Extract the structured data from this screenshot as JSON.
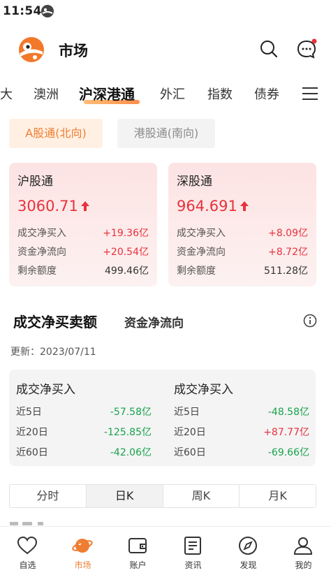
{
  "status_bar": {
    "time": "11:54"
  },
  "header": {
    "title": "市场"
  },
  "market_tabs": [
    {
      "label": "大"
    },
    {
      "label": "澳洲"
    },
    {
      "label": "沪深港通",
      "active": true
    },
    {
      "label": "外汇"
    },
    {
      "label": "指数"
    },
    {
      "label": "债券"
    }
  ],
  "sub_tabs": [
    {
      "label": "A股通(北向)",
      "active": true
    },
    {
      "label": "港股通(南向)"
    }
  ],
  "cards": [
    {
      "title": "沪股通",
      "index": "3060.71",
      "rows": [
        {
          "label": "成交净买入",
          "value": "+19.36亿"
        },
        {
          "label": "资金净流向",
          "value": "+20.54亿"
        },
        {
          "label": "剩余额度",
          "value": "499.46亿"
        }
      ]
    },
    {
      "title": "深股通",
      "index": "964.691",
      "rows": [
        {
          "label": "成交净买入",
          "value": "+8.09亿"
        },
        {
          "label": "资金净流向",
          "value": "+8.72亿"
        },
        {
          "label": "剩余额度",
          "value": "511.28亿"
        }
      ]
    }
  ],
  "section": {
    "tab_net": "成交净买卖额",
    "tab_flow": "资金净流向",
    "update_label": "更新：2023/07/11"
  },
  "period_stats": [
    {
      "title": "成交净买入",
      "rows": [
        {
          "label": "近5日",
          "value": "-57.58亿"
        },
        {
          "label": "近20日",
          "value": "-125.85亿"
        },
        {
          "label": "近60日",
          "value": "-42.06亿"
        }
      ]
    },
    {
      "title": "成交净买入",
      "rows": [
        {
          "label": "近5日",
          "value": "-48.58亿"
        },
        {
          "label": "近20日",
          "value": "+87.77亿"
        },
        {
          "label": "近60日",
          "value": "-69.66亿"
        }
      ]
    }
  ],
  "kline_tabs": [
    {
      "label": "分时"
    },
    {
      "label": "日K",
      "active": true
    },
    {
      "label": "周K"
    },
    {
      "label": "月K"
    }
  ],
  "bottom_nav": [
    {
      "label": "自选",
      "icon": "heart-icon"
    },
    {
      "label": "市场",
      "icon": "planet-icon",
      "active": true
    },
    {
      "label": "账户",
      "icon": "wallet-icon"
    },
    {
      "label": "资讯",
      "icon": "news-icon"
    },
    {
      "label": "发现",
      "icon": "compass-icon"
    },
    {
      "label": "我的",
      "icon": "user-icon"
    }
  ],
  "colors": {
    "accent": "#ef7d31",
    "up": "#e8313c",
    "down": "#17a34a",
    "card_bg": "#fde3e3"
  }
}
